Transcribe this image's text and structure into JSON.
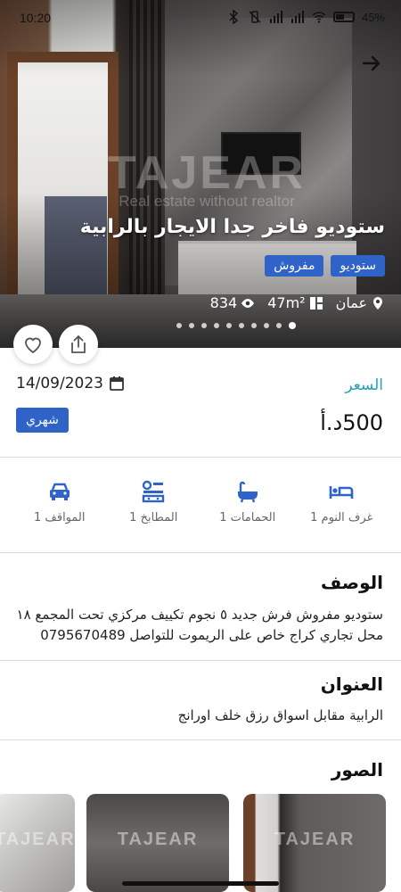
{
  "status_bar": {
    "time": "10:20",
    "battery": "45%"
  },
  "hero": {
    "watermark_logo": "TAJEAR",
    "watermark_sub": "Real estate without realtor",
    "title": "ستوديو فاخر جدا الايجار بالرابية",
    "tags": [
      "ستوديو",
      "مفروش"
    ],
    "location": "عمان",
    "area": "47m²",
    "views": "834",
    "slides_total": 10,
    "active_slide": 10
  },
  "price": {
    "label": "السعر",
    "value": "500د.أ",
    "date": "14/09/2023",
    "period": "شهري"
  },
  "features": [
    {
      "icon": "bed-icon",
      "label": "غرف النوم 1"
    },
    {
      "icon": "bathtub-icon",
      "label": "الحمامات 1"
    },
    {
      "icon": "kitchen-icon",
      "label": "المطابخ 1"
    },
    {
      "icon": "car-icon",
      "label": "المواقف 1"
    }
  ],
  "description": {
    "title": "الوصف",
    "body": "ستوديو مفروش فرش جديد ٥ نجوم تكييف مركزي تحت المجمع ١٨ محل تجاري كراج خاص على الريموت للتواصل 0795670489"
  },
  "address": {
    "title": "العنوان",
    "body": "الرابية مقابل اسواق رزق خلف اورانج"
  },
  "photos": {
    "title": "الصور",
    "watermark": "TAJEAR"
  },
  "colors": {
    "accent_blue": "#2f63c7",
    "price_label": "#27a0b8",
    "feature_icon": "#2f63c7"
  }
}
